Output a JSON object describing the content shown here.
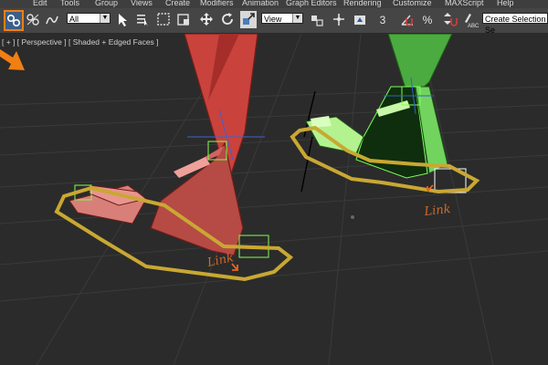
{
  "menus": [
    "Edit",
    "Tools",
    "Group",
    "Views",
    "Create",
    "Modifiers",
    "Animation",
    "Graph Editors",
    "Rendering",
    "Customize",
    "MAXScript",
    "Help"
  ],
  "toolbar": {
    "link_icon": "link-icon",
    "unlink_icon": "unlink-icon",
    "bind_icon": "bind-space-warp-icon",
    "filter_value": "All",
    "coord_value": "View",
    "snap_label": "3",
    "percent_label": "%",
    "named_selection_placeholder": "Create Selection Se"
  },
  "viewport": {
    "label": "[ + ] [ Perspective ] [ Shaded + Edged Faces ]",
    "annotation_left": "Link",
    "annotation_right": "Link"
  },
  "colors": {
    "highlight": "#f07f14",
    "red_object": "#c94a44",
    "green_object": "#3f9a38",
    "ground_ring": "#c9a832"
  }
}
